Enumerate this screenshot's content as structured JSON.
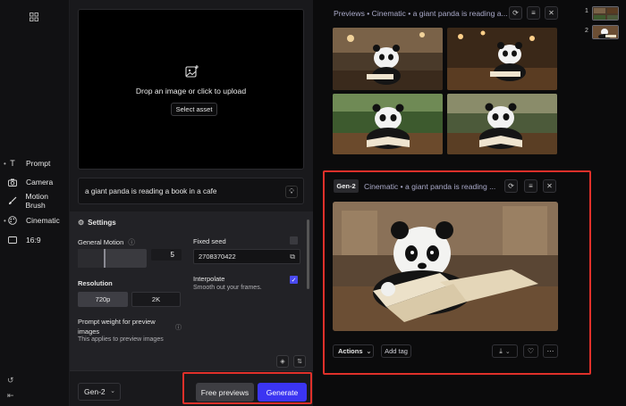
{
  "sidebar": {
    "items": [
      {
        "label": "Prompt",
        "icon": "text-t-icon",
        "dot": "•"
      },
      {
        "label": "Camera",
        "icon": "camera-icon",
        "dot": ""
      },
      {
        "label": "Motion Brush",
        "icon": "brush-icon",
        "dot": ""
      },
      {
        "label": "Cinematic",
        "icon": "palette-icon",
        "dot": "•"
      },
      {
        "label": "16:9",
        "icon": "aspect-ratio-icon",
        "dot": ""
      }
    ]
  },
  "upload": {
    "drop_text": "Drop an image or click to upload",
    "select_label": "Select asset"
  },
  "prompt": {
    "text": "a giant panda is reading a book in a cafe"
  },
  "settings": {
    "title": "Settings",
    "general_motion_label": "General Motion",
    "general_motion_value": "5",
    "general_motion_level": 0.38,
    "fixed_seed_label": "Fixed seed",
    "fixed_seed_value": "2708370422",
    "resolution_label": "Resolution",
    "resolution_options": [
      "720p",
      "2K"
    ],
    "resolution_selected": "720p",
    "interpolate_label": "Interpolate",
    "interpolate_desc": "Smooth out your frames.",
    "interpolate_checked": true,
    "prompt_weight_label": "Prompt weight for preview images",
    "prompt_weight_desc": "This applies to preview images"
  },
  "footer": {
    "model": "Gen-2",
    "free_previews_label": "Free previews",
    "generate_label": "Generate"
  },
  "previews": {
    "header": "Previews • Cinematic • a giant panda is reading a..."
  },
  "generation": {
    "tag": "Gen-2",
    "title": "Cinematic • a giant panda is reading ...",
    "actions_label": "Actions",
    "add_tag_label": "Add tag"
  },
  "strip": {
    "items": [
      "1",
      "2"
    ]
  },
  "colors": {
    "accent": "#3b35f2",
    "highlight": "#e0302a"
  }
}
